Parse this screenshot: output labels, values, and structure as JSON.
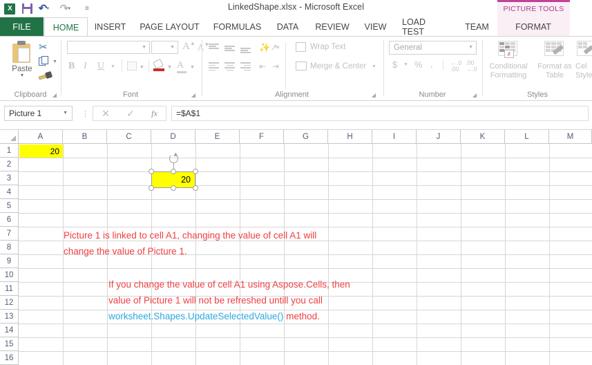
{
  "window": {
    "title": "LinkedShape.xlsx - Microsoft Excel",
    "quick_access": [
      {
        "name": "excel-logo",
        "label": "X"
      },
      {
        "name": "save-icon",
        "label": "Save"
      },
      {
        "name": "undo-icon",
        "label": "Undo"
      },
      {
        "name": "redo-icon",
        "label": "Redo"
      },
      {
        "name": "customize-qat-icon",
        "label": "Customize Quick Access Toolbar"
      }
    ]
  },
  "contextual_tools": {
    "label": "PICTURE TOOLS",
    "tab": "FORMAT",
    "accent_color": "#c0439a",
    "background": "#fbeff6"
  },
  "tabs": [
    {
      "label": "FILE",
      "active": false
    },
    {
      "label": "HOME",
      "active": true
    },
    {
      "label": "INSERT",
      "active": false
    },
    {
      "label": "PAGE LAYOUT",
      "active": false
    },
    {
      "label": "FORMULAS",
      "active": false
    },
    {
      "label": "DATA",
      "active": false
    },
    {
      "label": "REVIEW",
      "active": false
    },
    {
      "label": "VIEW",
      "active": false
    },
    {
      "label": "LOAD TEST",
      "active": false
    },
    {
      "label": "TEAM",
      "active": false
    }
  ],
  "ribbon": {
    "clipboard": {
      "label": "Clipboard",
      "paste": "Paste",
      "cut": "Cut",
      "copy": "Copy",
      "format_painter": "Format Painter"
    },
    "font": {
      "label": "Font",
      "font_name": "",
      "font_name_placeholder": "",
      "font_size": "",
      "grow_font": "A",
      "shrink_font": "A",
      "bold": "B",
      "italic": "I",
      "underline": "U"
    },
    "alignment": {
      "label": "Alignment",
      "wrap_text": "Wrap Text",
      "merge_center": "Merge & Center"
    },
    "number": {
      "label": "Number",
      "format": "General",
      "currency": "$",
      "percent": "%",
      "comma": ",",
      "increase_decimal": ".00",
      "decrease_decimal": ".00"
    },
    "styles": {
      "label": "Styles",
      "conditional_formatting": "Conditional Formatting",
      "conditional_formatting_l1": "Conditional",
      "conditional_formatting_l2": "Formatting",
      "format_as_table": "Format as Table",
      "format_as_table_l1": "Format as",
      "format_as_table_l2": "Table",
      "cell_styles": "Cell Styles",
      "cell_styles_l1": "Cel",
      "cell_styles_l2": "Style"
    }
  },
  "formula_bar": {
    "name_box": "Picture 1",
    "cancel": "✕",
    "enter": "✓",
    "insert_function": "fx",
    "formula": "=$A$1"
  },
  "grid": {
    "columns": [
      "A",
      "B",
      "C",
      "D",
      "E",
      "F",
      "G",
      "H",
      "I",
      "J",
      "K",
      "L",
      "M"
    ],
    "rows": [
      "1",
      "2",
      "3",
      "4",
      "5",
      "6",
      "7",
      "8",
      "9",
      "10",
      "11",
      "12",
      "13",
      "14",
      "15",
      "16"
    ],
    "cells": [
      {
        "ref": "A1",
        "value": "20",
        "fill": "#FFFF00",
        "align": "right"
      }
    ],
    "shape": {
      "name": "Picture 1",
      "value": "20",
      "fill": "#FFFF00",
      "linked_to": "=$A$1",
      "selected": true
    },
    "annotations": [
      {
        "id": "note-1",
        "color": "#ef3e42",
        "lines": [
          [
            {
              "text": "Picture 1 is linked to cell A1, changing the value of cell A1 will",
              "color": "#ef3e42"
            }
          ],
          [
            {
              "text": "change the value of Picture 1.",
              "color": "#ef3e42"
            }
          ]
        ]
      },
      {
        "id": "note-2",
        "color": "#ef3e42",
        "lines": [
          [
            {
              "text": "If you change the value of cell A1 using Aspose.Cells, then",
              "color": "#ef3e42"
            }
          ],
          [
            {
              "text": "value of Picture 1 will not be refreshed untill you call",
              "color": "#ef3e42"
            }
          ],
          [
            {
              "text": "worksheet.Shapes.UpdateSelectedValue()",
              "color": "#2ca8e0"
            },
            {
              "text": " method.",
              "color": "#ef3e42"
            }
          ]
        ]
      }
    ]
  }
}
